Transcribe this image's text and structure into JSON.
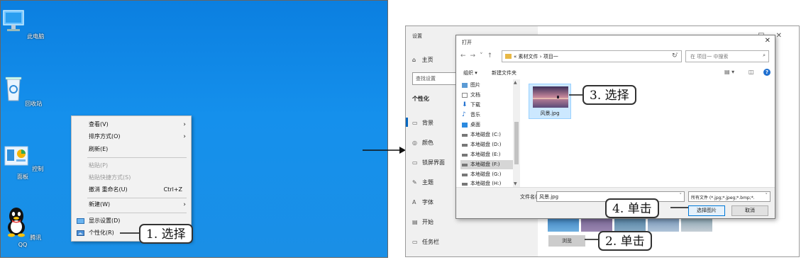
{
  "desktop": {
    "icons": [
      {
        "label": "此电脑",
        "icon": "computer-icon"
      },
      {
        "label": "回收站",
        "icon": "recycle-bin-icon"
      },
      {
        "label": "控制面板",
        "icon": "control-panel-icon"
      },
      {
        "label": "腾讯QQ",
        "icon": "qq-penguin-icon"
      }
    ]
  },
  "context_menu": {
    "items": [
      {
        "label": "查看(V)",
        "arrow": "›"
      },
      {
        "label": "排序方式(O)",
        "arrow": "›"
      },
      {
        "label": "刷新(E)"
      },
      {
        "label": "粘贴(P)"
      },
      {
        "label": "粘贴快捷方式(S)"
      },
      {
        "label": "撤消 重命名(U)",
        "shortcut": "Ctrl+Z"
      },
      {
        "label": "新建(W)",
        "arrow": "›"
      },
      {
        "label": "显示设置(D)"
      },
      {
        "label": "个性化(R)"
      }
    ]
  },
  "callouts": {
    "step1": "1. 选择",
    "step2": "2. 单击",
    "step3": "3. 选择",
    "step4": "4. 单击"
  },
  "settings": {
    "title": "设置",
    "home": "主页",
    "search_placeholder": "查找设置",
    "section": "个性化",
    "nav": [
      "背景",
      "颜色",
      "锁屏界面",
      "主题",
      "字体",
      "开始",
      "任务栏"
    ],
    "browse_label": "浏览"
  },
  "open_dialog": {
    "title": "打开",
    "address": "« 素材文件 › 项目一",
    "search_placeholder": "在 项目一 中搜索",
    "toolbar": {
      "organize": "组织 ▾",
      "new_folder": "新建文件夹"
    },
    "tree": [
      "图片",
      "文档",
      "下载",
      "音乐",
      "桌面",
      "本地磁盘 (C:)",
      "本地磁盘 (D:)",
      "本地磁盘 (E:)",
      "本地磁盘 (F:)",
      "本地磁盘 (G:)",
      "本地磁盘 (H:)"
    ],
    "selected_tree_item": "本地磁盘 (F:)",
    "file_name": "风景.jpg",
    "filename_label": "文件名(N):",
    "filename_value": "风景.jpg",
    "filter_value": "所有文件 (*.jpg;*.jpeg;*.bmp;*.",
    "open_button": "选择图片",
    "cancel_button": "取消"
  },
  "colors": {
    "desktop_blue": "#1590ec",
    "selection_blue": "#cce8ff",
    "accent": "#0078d7"
  }
}
